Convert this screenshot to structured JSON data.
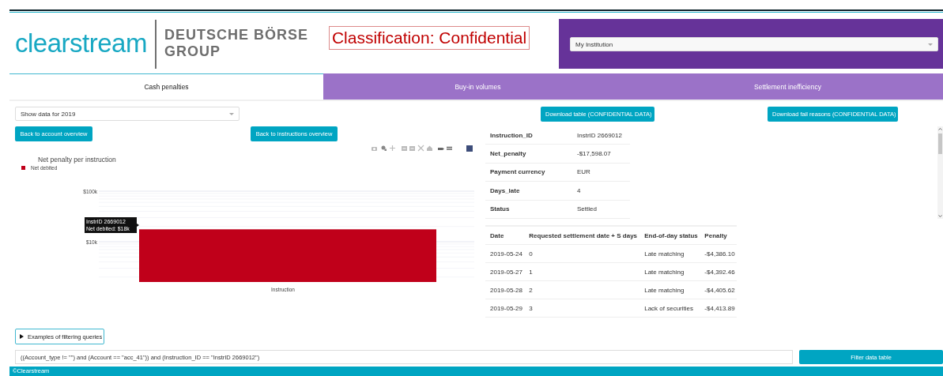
{
  "header": {
    "logo": "clearstream",
    "group_line_1": "DEUTSCHE BÖRSE",
    "group_line_2": "GROUP",
    "classification": "Classification: Confidential",
    "institution_select": {
      "value": "My Institution"
    }
  },
  "tabs": [
    {
      "label": "Cash penalties",
      "selected": true
    },
    {
      "label": "Buy-in volumes",
      "selected": false
    },
    {
      "label": "Settlement inefficiency",
      "selected": false
    }
  ],
  "year_select": {
    "value": "Show data for 2019"
  },
  "navigation_buttons": [
    "Back to account overview",
    "Back to instructions overview"
  ],
  "download_buttons": [
    "Download table (CONFIDENTIAL DATA)",
    "Download fail reasons (CONFIDENTIAL DATA)"
  ],
  "chart": {
    "title": "Net penalty per instruction",
    "legend": [
      {
        "label": "Net debited",
        "color": "#c0001a"
      }
    ],
    "y_axis_labels": [
      "$100k",
      "$10k"
    ],
    "x_axis_label": "Instruction",
    "tooltip": [
      "InstrID 2669012",
      "Net debited: $18k"
    ]
  },
  "details": [
    {
      "label": "Instruction_ID",
      "value": "InstrID 2669012"
    },
    {
      "label": "Net_penalty",
      "value": "-$17,598.07"
    },
    {
      "label": "Payment currency",
      "value": "EUR"
    },
    {
      "label": "Days_late",
      "value": "4"
    },
    {
      "label": "Status",
      "value": "Settled"
    }
  ],
  "penalty_table": {
    "columns": [
      "Date",
      "Requested settlement date + S days",
      "End-of-day status",
      "Penalty"
    ],
    "rows": [
      [
        "2019-05-24",
        "0",
        "Late matching",
        "-$4,386.10"
      ],
      [
        "2019-05-27",
        "1",
        "Late matching",
        "-$4,392.46"
      ],
      [
        "2019-05-28",
        "2",
        "Late matching",
        "-$4,405.62"
      ],
      [
        "2019-05-29",
        "3",
        "Lack of securities",
        "-$4,413.89"
      ]
    ]
  },
  "filter": {
    "examples_toggle": "Examples of filtering queries",
    "query": "((Account_type != \"\") and (Account == \"acc_41\")) and (Instruction_ID == \"InstrID 2669012\")",
    "button": "Filter data table"
  },
  "footer": "©Clearstream"
}
